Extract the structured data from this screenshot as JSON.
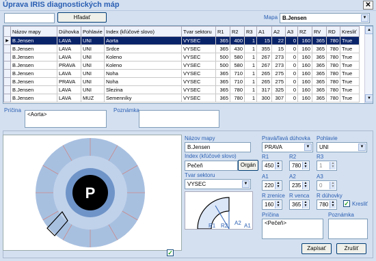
{
  "window": {
    "title": "Úprava IRIS diagnostických máp",
    "close": "✕"
  },
  "search": {
    "value": "",
    "button": "Hľadať"
  },
  "map_filter": {
    "label": "Mapa",
    "value": "B.Jensen"
  },
  "table": {
    "columns": [
      "Názov mapy",
      "Dúhovka",
      "Pohlavie",
      "Index (kľúčové slovo)",
      "Tvar sektoru",
      "R1",
      "R2",
      "R3",
      "A1",
      "A2",
      "A3",
      "RZ",
      "RV",
      "RD",
      "Kresliť"
    ],
    "rows": [
      [
        "B.Jensen",
        "LAVA",
        "UNI",
        "Aorta",
        "VYSEC",
        "365",
        "400",
        "1",
        "15",
        "22",
        "0",
        "160",
        "365",
        "780",
        "True"
      ],
      [
        "B.Jensen",
        "LAVA",
        "UNI",
        "Srdce",
        "VYSEC",
        "365",
        "430",
        "1",
        "355",
        "15",
        "0",
        "160",
        "365",
        "780",
        "True"
      ],
      [
        "B.Jensen",
        "LAVA",
        "UNI",
        "Koleno",
        "VYSEC",
        "500",
        "580",
        "1",
        "267",
        "273",
        "0",
        "160",
        "365",
        "780",
        "True"
      ],
      [
        "B.Jensen",
        "PRAVA",
        "UNI",
        "Koleno",
        "VYSEC",
        "500",
        "580",
        "1",
        "267",
        "273",
        "0",
        "160",
        "365",
        "780",
        "True"
      ],
      [
        "B.Jensen",
        "LAVA",
        "UNI",
        "Noha",
        "VYSEC",
        "365",
        "710",
        "1",
        "265",
        "275",
        "0",
        "160",
        "365",
        "780",
        "True"
      ],
      [
        "B.Jensen",
        "PRAVA",
        "UNI",
        "Noha",
        "VYSEC",
        "365",
        "710",
        "1",
        "265",
        "275",
        "0",
        "160",
        "365",
        "780",
        "True"
      ],
      [
        "B.Jensen",
        "LAVA",
        "UNI",
        "Slezina",
        "VYSEC",
        "365",
        "780",
        "1",
        "317",
        "325",
        "0",
        "160",
        "365",
        "780",
        "True"
      ],
      [
        "B.Jensen",
        "LAVA",
        "MUZ",
        "Semenníky",
        "VYSEC",
        "365",
        "780",
        "1",
        "300",
        "307",
        "0",
        "160",
        "365",
        "780",
        "True"
      ]
    ],
    "selected_row": 0
  },
  "row_detail": {
    "cause_label": "Príčina",
    "cause_value": "<Aorta>",
    "note_label": "Poznámka",
    "note_value": ""
  },
  "diagram": {
    "center_letter": "P",
    "check": "✓"
  },
  "form": {
    "map_name": {
      "label": "Názov mapy",
      "value": "B.Jensen"
    },
    "iris_side": {
      "label": "Pravá/ľavá dúhovka",
      "value": "PRAVA"
    },
    "gender": {
      "label": "Pohlavie",
      "value": "UNI"
    },
    "index": {
      "label": "Index (kľúčové slovo)",
      "value": "Pečeň",
      "button": "Orgán"
    },
    "shape": {
      "label": "Tvar sektoru",
      "value": "VYSEC"
    },
    "r1": {
      "label": "R1",
      "value": "450"
    },
    "r2": {
      "label": "R2",
      "value": "780"
    },
    "r3": {
      "label": "R3",
      "value": "1"
    },
    "a1": {
      "label": "A1",
      "value": "220"
    },
    "a2": {
      "label": "A2",
      "value": "235"
    },
    "a3": {
      "label": "A3",
      "value": "0"
    },
    "pupil_r": {
      "label": "R zrenice",
      "value": "160"
    },
    "wreath_r": {
      "label": "R venca",
      "value": "365"
    },
    "iris_r": {
      "label": "R dúhovky",
      "value": "780"
    },
    "draw": {
      "label": "Kresliť",
      "checked": true
    },
    "cause": {
      "label": "Príčina",
      "value": "<Pečeň>"
    },
    "note": {
      "label": "Poznámka",
      "value": ""
    },
    "save_button": "Zapísať",
    "cancel_button": "Zrušiť"
  },
  "sector_sketch": {
    "labels": [
      "R1",
      "R2",
      "A2",
      "A1"
    ]
  },
  "colors": {
    "selection": "#0a246a",
    "label": "#2a5fb3",
    "iris_ring": "#a8c0e0",
    "iris_ring_inner": "#6f94c8",
    "sector_edge": "#cc8888"
  }
}
